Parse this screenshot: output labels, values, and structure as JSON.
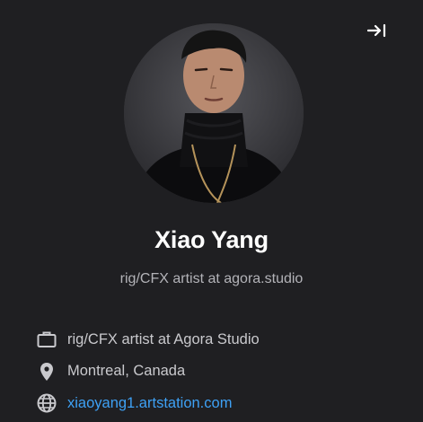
{
  "profile": {
    "name": "Xiao Yang",
    "headline": "rig/CFX artist at agora.studio"
  },
  "details": {
    "job": "rig/CFX artist at Agora Studio",
    "location": "Montreal, Canada",
    "website": "xiaoyang1.artstation.com"
  },
  "icons": {
    "collapse": "collapse-sidebar-icon",
    "job": "briefcase-icon",
    "location": "location-pin-icon",
    "website": "globe-icon"
  },
  "colors": {
    "background": "#1f1f22",
    "name": "#ffffff",
    "text": "#c9c9cd",
    "link": "#3ea1f5"
  }
}
